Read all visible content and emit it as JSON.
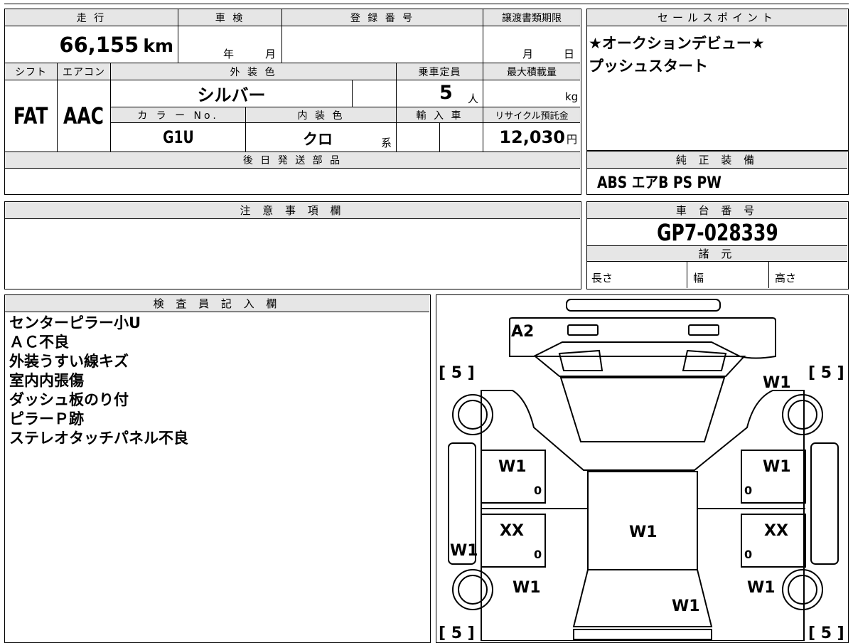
{
  "top_info": {
    "labels": {
      "mileage": "走 行",
      "inspection": "車 検",
      "registration": "登 録 番 号",
      "transfer_deadline": "譲渡書類期限",
      "shift": "シフト",
      "aircon": "エアコン",
      "exterior_color": "外 装 色",
      "capacity": "乗車定員",
      "max_load": "最大積載量",
      "color_no": "カ ラ ー No.",
      "interior_color": "内 装 色",
      "import": "輸 入 車",
      "recycle": "リサイクル預託金",
      "later_parts": "後 日 発 送 部 品"
    },
    "mileage_value": "66,155",
    "mileage_unit": "km",
    "year_label": "年",
    "month_label": "月",
    "deadline_month": "月",
    "deadline_day": "日",
    "shift_value": "FAT",
    "aircon_value": "AAC",
    "exterior_color_value": "シルバー",
    "capacity_value": "5",
    "capacity_unit": "人",
    "max_load_unit": "kg",
    "color_no_value": "G1U",
    "interior_color_value": "クロ",
    "interior_suffix": "系",
    "recycle_value": "12,030",
    "recycle_unit": "円"
  },
  "sales_points": {
    "header": "セールスポイント",
    "lines": [
      "★オークションデビュー★",
      "プッシュスタート"
    ]
  },
  "equipment": {
    "header": "純 正 装 備",
    "value": "ABS エアB PS PW"
  },
  "notes": {
    "header": "注 意 事 項 欄"
  },
  "chassis": {
    "header": "車 台 番 号",
    "value": "GP7-028339",
    "specs_header": "諸 元",
    "length_label": "長さ",
    "width_label": "幅",
    "height_label": "高さ"
  },
  "inspector": {
    "header": "検 査 員 記 入 欄",
    "lines": [
      "センターピラー小U",
      "ＡＣ不良",
      "外装うすい線キズ",
      "室内内張傷",
      "ダッシュ板のり付",
      "ピラーＰ跡",
      "ステレオタッチパネル不良"
    ]
  },
  "diagram": {
    "marks": {
      "front_top": "A2",
      "tire_fl_bracket": "[ 5 ]",
      "tire_fr_bracket": "[ 5 ]",
      "tire_rl_bracket": "[ 5 ]",
      "tire_rr_bracket": "[ 5 ]",
      "fender_right": "W1",
      "door_fl": "W1",
      "door_fr": "W1",
      "door_rl": "XX",
      "door_rr": "XX",
      "roof": "W1",
      "rocker_left": "W1",
      "quarter_left": "W1",
      "quarter_right": "W1",
      "rear": "W1",
      "zero_fl": "0",
      "zero_fr": "0",
      "zero_rl": "0",
      "zero_rr": "0"
    }
  }
}
